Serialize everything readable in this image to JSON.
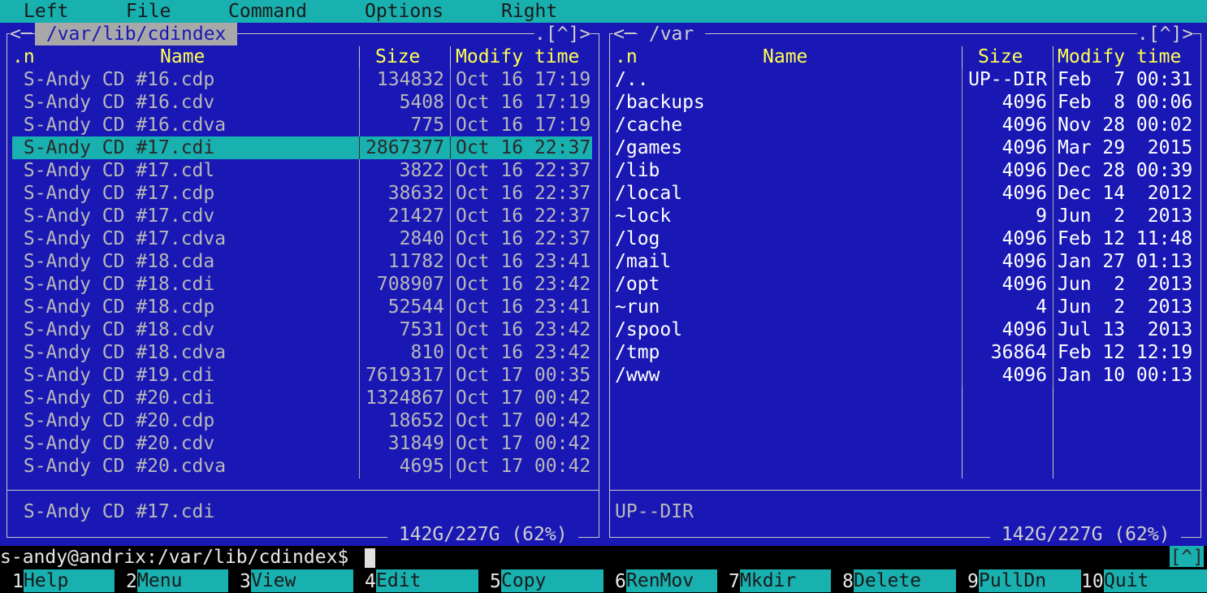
{
  "menu": [
    "Left",
    "File",
    "Command",
    "Options",
    "Right"
  ],
  "left_panel": {
    "path": " /var/lib/cdindex ",
    "left_arrow": "<─",
    "corner_controls": ".[^]>",
    "headers": {
      "n": ".n",
      "name": "Name",
      "size": "Size",
      "time": "Modify time"
    },
    "rows": [
      {
        "name": " S-Andy CD #16.cdp",
        "size": "134832",
        "time": "Oct 16 17:19"
      },
      {
        "name": " S-Andy CD #16.cdv",
        "size": "5408",
        "time": "Oct 16 17:19"
      },
      {
        "name": " S-Andy CD #16.cdva",
        "size": "775",
        "time": "Oct 16 17:19"
      },
      {
        "name": " S-Andy CD #17.cdi",
        "size": "2867377",
        "time": "Oct 16 22:37",
        "selected": true
      },
      {
        "name": " S-Andy CD #17.cdl",
        "size": "3822",
        "time": "Oct 16 22:37"
      },
      {
        "name": " S-Andy CD #17.cdp",
        "size": "38632",
        "time": "Oct 16 22:37"
      },
      {
        "name": " S-Andy CD #17.cdv",
        "size": "21427",
        "time": "Oct 16 22:37"
      },
      {
        "name": " S-Andy CD #17.cdva",
        "size": "2840",
        "time": "Oct 16 22:37"
      },
      {
        "name": " S-Andy CD #18.cda",
        "size": "11782",
        "time": "Oct 16 23:41"
      },
      {
        "name": " S-Andy CD #18.cdi",
        "size": "708907",
        "time": "Oct 16 23:42"
      },
      {
        "name": " S-Andy CD #18.cdp",
        "size": "52544",
        "time": "Oct 16 23:41"
      },
      {
        "name": " S-Andy CD #18.cdv",
        "size": "7531",
        "time": "Oct 16 23:42"
      },
      {
        "name": " S-Andy CD #18.cdva",
        "size": "810",
        "time": "Oct 16 23:42"
      },
      {
        "name": " S-Andy CD #19.cdi",
        "size": "7619317",
        "time": "Oct 17 00:35"
      },
      {
        "name": " S-Andy CD #20.cdi",
        "size": "1324867",
        "time": "Oct 17 00:42"
      },
      {
        "name": " S-Andy CD #20.cdp",
        "size": "18652",
        "time": "Oct 17 00:42"
      },
      {
        "name": " S-Andy CD #20.cdv",
        "size": "31849",
        "time": "Oct 17 00:42"
      },
      {
        "name": " S-Andy CD #20.cdva",
        "size": "4695",
        "time": "Oct 17 00:42"
      }
    ],
    "mini_status": " S-Andy CD #17.cdi",
    "disk_info": " 142G/227G (62%) "
  },
  "right_panel": {
    "path": " /var ",
    "left_arrow": "<─",
    "corner_controls": ".[^]>",
    "headers": {
      "n": ".n",
      "name": "Name",
      "size": "Size",
      "time": "Modify time"
    },
    "rows": [
      {
        "name": "/..",
        "size": "UP--DIR",
        "time": "Feb  7 00:31"
      },
      {
        "name": "/backups",
        "size": "4096",
        "time": "Feb  8 00:06"
      },
      {
        "name": "/cache",
        "size": "4096",
        "time": "Nov 28 00:02"
      },
      {
        "name": "/games",
        "size": "4096",
        "time": "Mar 29  2015"
      },
      {
        "name": "/lib",
        "size": "4096",
        "time": "Dec 28 00:39"
      },
      {
        "name": "/local",
        "size": "4096",
        "time": "Dec 14  2012"
      },
      {
        "name": "~lock",
        "size": "9",
        "time": "Jun  2  2013"
      },
      {
        "name": "/log",
        "size": "4096",
        "time": "Feb 12 11:48"
      },
      {
        "name": "/mail",
        "size": "4096",
        "time": "Jan 27 01:13"
      },
      {
        "name": "/opt",
        "size": "4096",
        "time": "Jun  2  2013"
      },
      {
        "name": "~run",
        "size": "4",
        "time": "Jun  2  2013"
      },
      {
        "name": "/spool",
        "size": "4096",
        "time": "Jul 13  2013"
      },
      {
        "name": "/tmp",
        "size": "36864",
        "time": "Feb 12 12:19"
      },
      {
        "name": "/www",
        "size": "4096",
        "time": "Jan 10 00:13"
      }
    ],
    "mini_status": "UP--DIR",
    "disk_info": " 142G/227G (62%) "
  },
  "command_line": {
    "prompt": "s-andy@andrix:/var/lib/cdindex$",
    "value": "",
    "caret_label": "[^]"
  },
  "function_keys": [
    {
      "num": "1",
      "label": "Help"
    },
    {
      "num": "2",
      "label": "Menu"
    },
    {
      "num": "3",
      "label": "View"
    },
    {
      "num": "4",
      "label": "Edit"
    },
    {
      "num": "5",
      "label": "Copy"
    },
    {
      "num": "6",
      "label": "RenMov"
    },
    {
      "num": "7",
      "label": "Mkdir"
    },
    {
      "num": "8",
      "label": "Delete"
    },
    {
      "num": "9",
      "label": "PullDn"
    },
    {
      "num": "10",
      "label": "Quit"
    }
  ],
  "colors": {
    "background": "#1a18b4",
    "accent": "#19b0b0",
    "header": "#ffff54"
  }
}
